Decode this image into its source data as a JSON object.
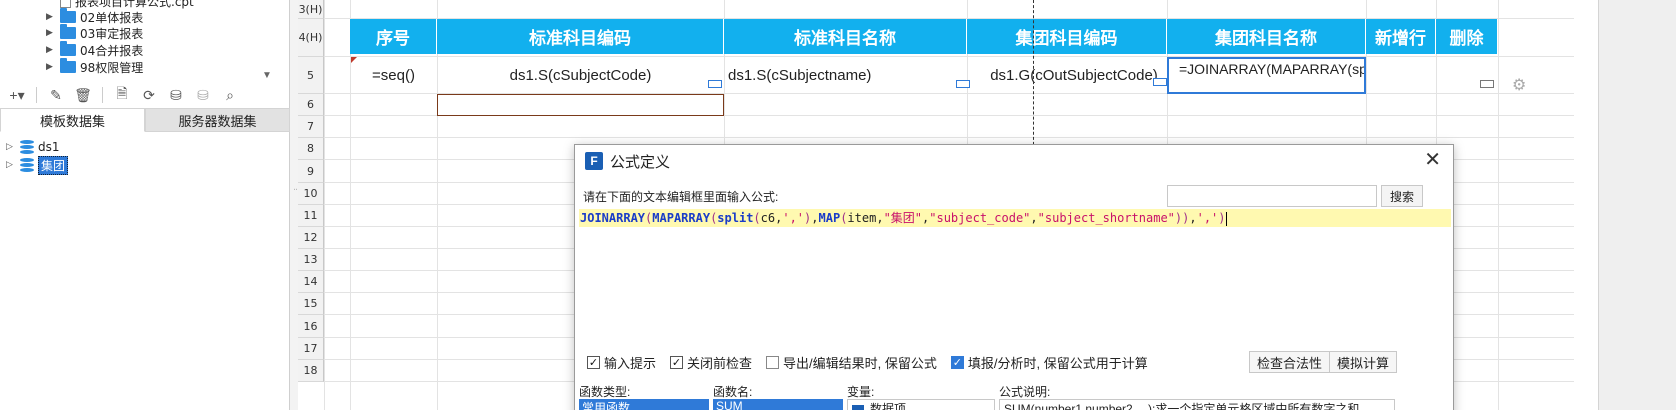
{
  "left_panel": {
    "tree_items": [
      {
        "label": "报表项目计算公式.cpt",
        "type": "file"
      },
      {
        "label": "02单体报表",
        "type": "folder"
      },
      {
        "label": "03审定报表",
        "type": "folder"
      },
      {
        "label": "04合并报表",
        "type": "folder"
      },
      {
        "label": "98权限管理",
        "type": "folder"
      }
    ],
    "tabs": [
      "模板数据集",
      "服务器数据集"
    ],
    "datasets": [
      {
        "label": "ds1",
        "selected": false
      },
      {
        "label": "集团",
        "selected": true
      }
    ]
  },
  "grid": {
    "row_headers": [
      "3(H)",
      "4(H)",
      "5",
      "6",
      "7",
      "8",
      "9",
      "10",
      "11",
      "12",
      "13",
      "14",
      "15",
      "16",
      "17",
      "18"
    ],
    "header_cells": [
      "序号",
      "标准科目编码",
      "标准科目名称",
      "集团科目编码",
      "集团科目名称",
      "新增行",
      "删除"
    ],
    "data_cells": [
      "=seq()",
      "ds1.S(cSubjectCode)",
      "ds1.S(cSubjectname)",
      "ds1.G(cOutSubjectCode)",
      "=JOINARRAY(MAPARRAY(split(c6,','),MAP(item,\"集"
    ],
    "header_color": "#12b0ee"
  },
  "dialog": {
    "title": "公式定义",
    "hint": "请在下面的文本编辑框里面输入公式:",
    "search_value": "",
    "search_button": "搜索",
    "formula_tokens": [
      {
        "t": "JOINARRAY",
        "c": "kw"
      },
      {
        "t": "(",
        "c": "paren"
      },
      {
        "t": "MAPARRAY",
        "c": "kw"
      },
      {
        "t": "(",
        "c": "paren"
      },
      {
        "t": "split",
        "c": "kw"
      },
      {
        "t": "(",
        "c": "paren"
      },
      {
        "t": "c6",
        "c": "plain"
      },
      {
        "t": ",",
        "c": "plain"
      },
      {
        "t": "','",
        "c": "str"
      },
      {
        "t": ")",
        "c": "paren"
      },
      {
        "t": ",",
        "c": "plain"
      },
      {
        "t": "MAP",
        "c": "kw"
      },
      {
        "t": "(",
        "c": "paren"
      },
      {
        "t": "item",
        "c": "plain"
      },
      {
        "t": ",",
        "c": "plain"
      },
      {
        "t": "\"集团\"",
        "c": "str"
      },
      {
        "t": ",",
        "c": "plain"
      },
      {
        "t": "\"subject_code\"",
        "c": "str"
      },
      {
        "t": ",",
        "c": "plain"
      },
      {
        "t": "\"subject_shortname\"",
        "c": "str"
      },
      {
        "t": "))",
        "c": "paren"
      },
      {
        "t": ",",
        "c": "plain"
      },
      {
        "t": "','",
        "c": "str"
      },
      {
        "t": ")",
        "c": "paren"
      }
    ],
    "options": [
      {
        "label": "输入提示",
        "checked": true,
        "style": "plain"
      },
      {
        "label": "关闭前检查",
        "checked": true,
        "style": "plain"
      },
      {
        "label": "导出/编辑结果时, 保留公式",
        "checked": false,
        "style": "plain"
      },
      {
        "label": "填报/分析时, 保留公式用于计算",
        "checked": true,
        "style": "blue"
      }
    ],
    "check_button": "检查合法性",
    "simulate_button": "模拟计算",
    "func_type_label": "函数类型:",
    "func_name_label": "函数名:",
    "var_label": "变量:",
    "desc_label": "公式说明:",
    "func_type_value": "常用函数",
    "func_name_value": "SUM",
    "var_value": "数据项",
    "desc_value": "SUM(number1,number2,…):求一个指定单元格区域中所有数字之和。"
  }
}
